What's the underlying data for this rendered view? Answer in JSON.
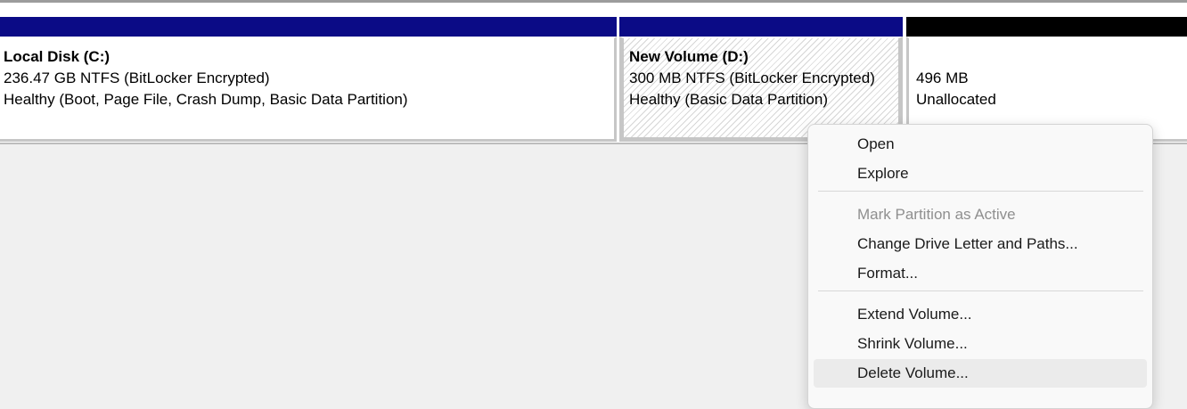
{
  "partitions": {
    "c": {
      "name": "Local Disk  (C:)",
      "size": "236.47 GB NTFS (BitLocker Encrypted)",
      "status": "Healthy (Boot, Page File, Crash Dump, Basic Data Partition)",
      "bar_color": "#0b0b86"
    },
    "d": {
      "name": "New Volume  (D:)",
      "size": "300 MB NTFS (BitLocker Encrypted)",
      "status": "Healthy (Basic Data Partition)",
      "bar_color": "#0b0b86"
    },
    "unallocated": {
      "size": "496 MB",
      "status": "Unallocated",
      "bar_color": "#000000"
    }
  },
  "context_menu": {
    "open": "Open",
    "explore": "Explore",
    "mark_active": "Mark Partition as Active",
    "change_letter": "Change Drive Letter and Paths...",
    "format": "Format...",
    "extend": "Extend Volume...",
    "shrink": "Shrink Volume...",
    "delete": "Delete Volume..."
  }
}
